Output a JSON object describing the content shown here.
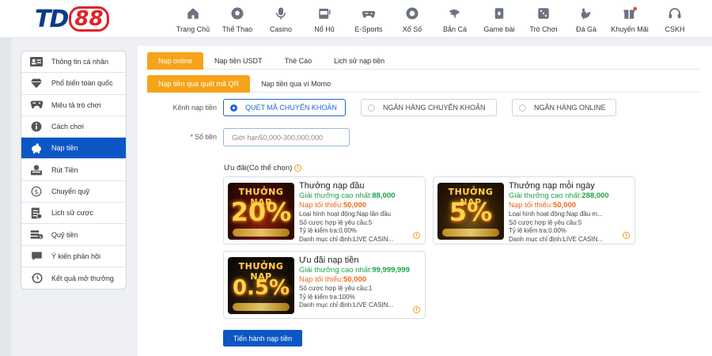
{
  "logo": {
    "td": "TD",
    "num": "88"
  },
  "nav": [
    {
      "label": "Trang Chủ",
      "icon": "home-icon"
    },
    {
      "label": "Thể Thao",
      "icon": "soccer-ball-icon"
    },
    {
      "label": "Casino",
      "icon": "microphone-icon"
    },
    {
      "label": "Nổ Hũ",
      "icon": "slot-machine-icon"
    },
    {
      "label": "E-Sports",
      "icon": "gamepad-icon"
    },
    {
      "label": "Xổ Số",
      "icon": "lottery-ball-icon"
    },
    {
      "label": "Bắn Cá",
      "icon": "fish-icon"
    },
    {
      "label": "Game bài",
      "icon": "cards-icon"
    },
    {
      "label": "Trò Chơi",
      "icon": "dice-icon"
    },
    {
      "label": "Đá Gà",
      "icon": "rooster-icon"
    },
    {
      "label": "Khuyến Mãi",
      "icon": "gift-icon"
    },
    {
      "label": "CSKH",
      "icon": "headset-icon"
    }
  ],
  "sidebar": {
    "items": [
      {
        "label": "Thông tin cá nhân",
        "icon": "id-card-icon"
      },
      {
        "label": "Phổ biến toàn quốc",
        "icon": "diamond-icon"
      },
      {
        "label": "Miêu tả trò chơi",
        "icon": "gamepad-icon"
      },
      {
        "label": "Cách chơi",
        "icon": "info-icon"
      },
      {
        "label": "Nạp tiền",
        "icon": "piggy-bank-icon"
      },
      {
        "label": "Rút Tiền",
        "icon": "withdraw-icon"
      },
      {
        "label": "Chuyển quỹ",
        "icon": "dollar-coin-icon"
      },
      {
        "label": "Lịch sử cược",
        "icon": "history-list-icon"
      },
      {
        "label": "Quỹ tiền",
        "icon": "money-stack-icon"
      },
      {
        "label": "Ý kiến phản hồi",
        "icon": "chat-icon"
      },
      {
        "label": "Kết quả mở thưởng",
        "icon": "clock-history-icon"
      }
    ],
    "active_index": 4
  },
  "tabs": [
    "Nạp online",
    "Nạp tiền USDT",
    "Thẻ Cào",
    "Lịch sử nạp tiền"
  ],
  "subtabs": [
    "Nạp tiền qua quét mã QR",
    "Nạp tiền qua ví Momo"
  ],
  "form": {
    "channel_label": "Kênh nạp tiền",
    "channels": [
      "QUÉT MÃ CHUYỂN KHOẢN",
      "NGÂN HÀNG CHUYỂN KHOẢN",
      "NGÂN HÀNG ONLINE"
    ],
    "amount_required": "*",
    "amount_label": "Số tiền",
    "amount_placeholder": "Giới hạn50,000-300,000,000",
    "promo_title": "Ưu đãi(Có thể chọn)",
    "info_glyph": "i",
    "submit_label": "Tiến hành nạp tiền"
  },
  "promos": [
    {
      "thumb_title": "THƯỞNG NẠP",
      "thumb_percent": "20%",
      "title": "Thưởng nạp đầu",
      "max_prefix": "Giải thưởng cao nhất:",
      "max_value": "88,000",
      "min_prefix": "Nạp tối thiểu:",
      "min_value": "50,000",
      "line1": "Loại hình hoạt động:Nạp lần đầu",
      "line2": "Số cược hợp lệ yêu cầu:5",
      "line3": "Tỷ lệ kiểm tra:0.00%",
      "line4": "Danh mục chỉ định:LIVE CASIN..."
    },
    {
      "thumb_title": "THƯỞNG NẠP",
      "thumb_percent": "5%",
      "title": "Thưởng nạp mỗi ngày",
      "max_prefix": "Giải thưởng cao nhất:",
      "max_value": "288,000",
      "min_prefix": "Nạp tối thiểu:",
      "min_value": "50,000",
      "line1": "Loại hình hoạt động:Nạp đầu m...",
      "line2": "Số cược hợp lệ yêu cầu:5",
      "line3": "Tỷ lệ kiểm tra:0.00%",
      "line4": "Danh mục chỉ định:LIVE CASIN..."
    },
    {
      "thumb_title": "THƯỞNG NẠP",
      "thumb_percent": "0.5%",
      "title": "Ưu đãi nạp tiền",
      "max_prefix": "Giải thưởng cao nhất:",
      "max_value": "99,999,999",
      "min_prefix": "Nạp tối thiểu:",
      "min_value": "50,000",
      "line1": "Số cược hợp lệ yêu cầu:1",
      "line2": "Tỷ lệ kiểm tra:100%",
      "line3": "Danh mục chỉ định:LIVE CASIN..."
    }
  ],
  "colors": {
    "accent_orange": "#f6a31a",
    "primary_blue": "#0d57c5",
    "green": "#1fa34a",
    "orange_text": "#ec6b1d",
    "logo_red": "#e0232a",
    "logo_blue": "#0d3b8c"
  }
}
